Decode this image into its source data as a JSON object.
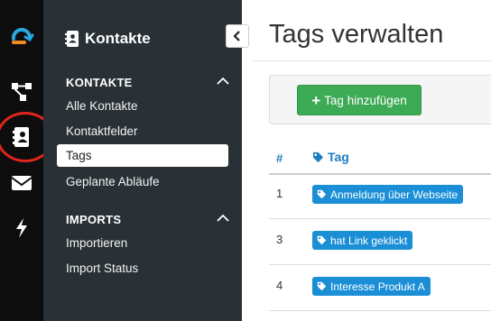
{
  "colors": {
    "rail_bg": "#0d0d0d",
    "sidebar_bg": "#293136",
    "accent_blue": "#1f7cbf",
    "tag_badge": "#1a8fd6",
    "add_button": "#3daa55",
    "highlight_ring": "#e0251b"
  },
  "rail": {
    "items": [
      {
        "icon": "app-logo-icon"
      },
      {
        "icon": "workflow-icon"
      },
      {
        "icon": "address-book-icon"
      },
      {
        "icon": "envelope-icon"
      },
      {
        "icon": "lightning-icon"
      }
    ]
  },
  "sidebar": {
    "title": "Kontakte",
    "title_icon": "address-book-icon",
    "sections": [
      {
        "label": "KONTAKTE",
        "items": [
          "Alle Kontakte",
          "Kontaktfelder",
          "Tags",
          "Geplante Abläufe"
        ],
        "active": "Tags"
      },
      {
        "label": "IMPORTS",
        "items": [
          "Importieren",
          "Import Status"
        ]
      }
    ]
  },
  "main": {
    "title": "Tags verwalten",
    "add_button_label": "Tag hinzufügen",
    "table": {
      "headers": [
        "#",
        "Tag"
      ],
      "rows": [
        {
          "id": "1",
          "tag": "Anmeldung über Webseite"
        },
        {
          "id": "3",
          "tag": "hat Link geklickt"
        },
        {
          "id": "4",
          "tag": "Interesse Produkt A"
        }
      ]
    }
  }
}
